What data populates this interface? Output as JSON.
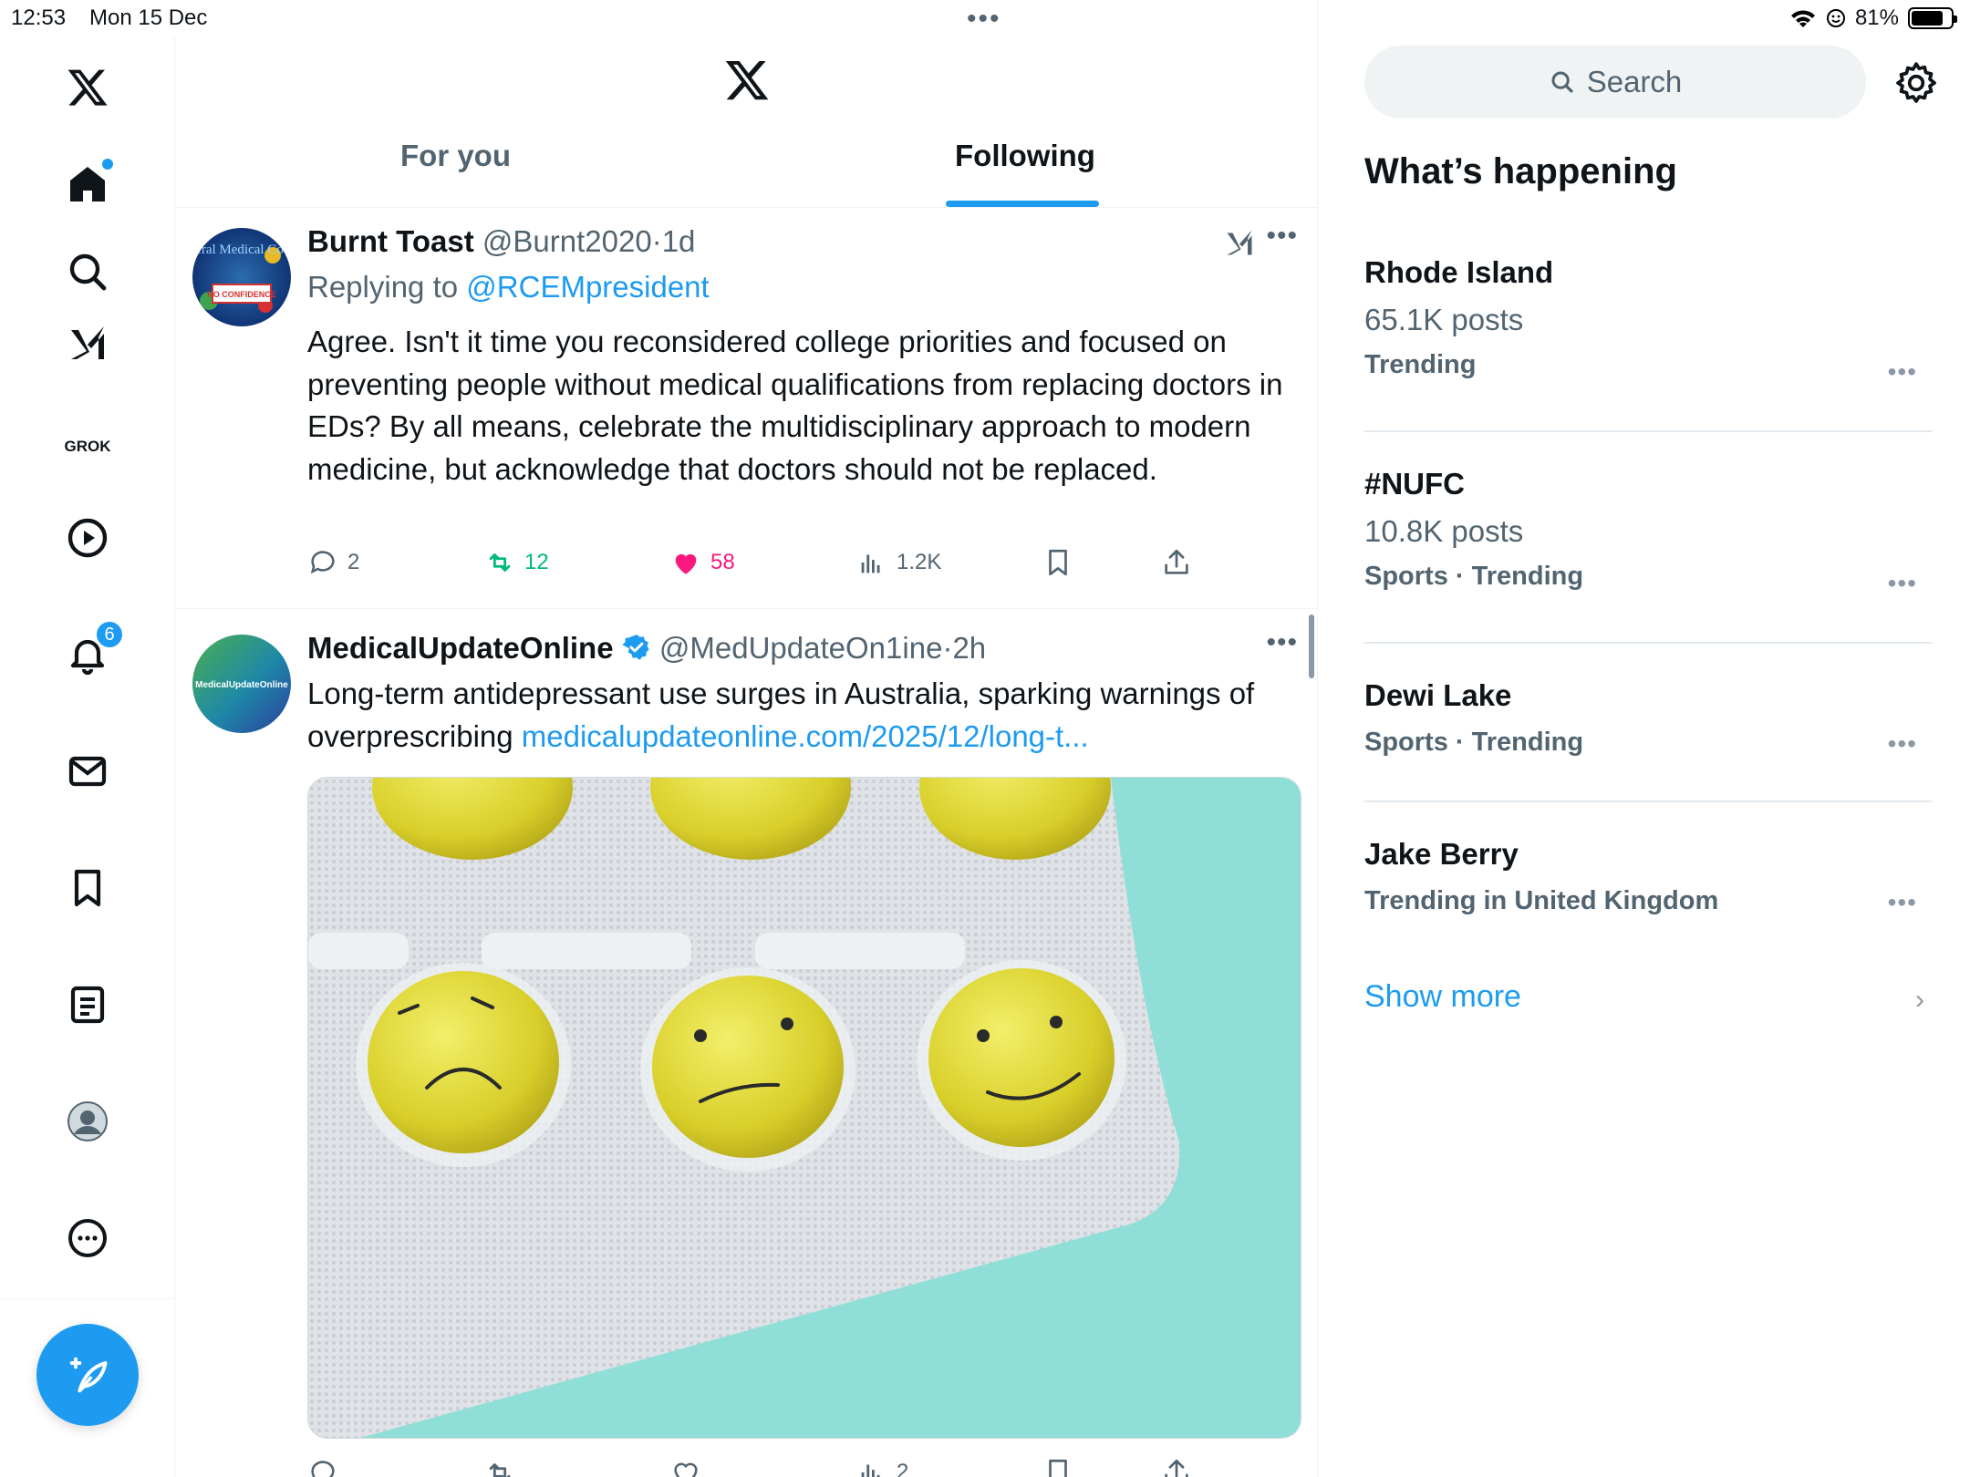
{
  "status_bar": {
    "time": "12:53",
    "date": "Mon 15 Dec",
    "battery": "81%",
    "battery_level": 0.81
  },
  "nav": {
    "grok_label": "GROK",
    "notifications_count": "6",
    "icons": [
      "x-logo-icon",
      "home-icon",
      "search-icon",
      "grok-icon",
      "video-icon",
      "bell-icon",
      "mail-icon",
      "bookmark-icon",
      "lists-icon",
      "profile-icon",
      "more-icon",
      "compose-icon"
    ]
  },
  "header": {
    "tabs": [
      {
        "label": "For you",
        "active": false
      },
      {
        "label": "Following",
        "active": true
      }
    ]
  },
  "tweets": [
    {
      "name": "Burnt Toast",
      "handle": "@Burnt2020",
      "sep": "·",
      "time": "1d",
      "replying_prefix": "Replying to",
      "replying_to": "@RCEMpresident",
      "avatar_text": "General Medical Council",
      "avatar_stamp": "NO CONFIDENCE",
      "text": "Agree. Isn't it time you reconsidered college priorities and focused on preventing people without medical qualifications from replacing doctors in EDs? By all means, celebrate the multidisciplinary approach to modern medicine, but acknowledge that doctors should not be replaced.",
      "stats": {
        "replies": "2",
        "reposts": "12",
        "likes": "58",
        "views": "1.2K"
      },
      "liked": true,
      "accent_colors": {
        "repost": "#00ba7c",
        "like": "#f91880"
      }
    },
    {
      "name": "MedicalUpdateOnline",
      "verified": true,
      "handle": "@MedUpdateOn1ine",
      "sep": "·",
      "time": "2h",
      "avatar_text": "MedicalUpdateOnline",
      "text": "Long-term antidepressant use surges in Australia, sparking warnings of overprescribing",
      "link": "medicalupdateonline.com/2025/12/long-t...",
      "stats": {
        "replies": "",
        "reposts": "",
        "likes": "",
        "views": "2"
      }
    }
  ],
  "sidebar": {
    "search_placeholder": "Search",
    "title": "What’s happening",
    "trends": [
      {
        "name": "Rhode Island",
        "posts": "65.1K posts",
        "context": "Trending"
      },
      {
        "name": "#NUFC",
        "posts": "10.8K posts",
        "context": "Sports · Trending"
      },
      {
        "name": "Dewi Lake",
        "posts": "",
        "context": "Sports · Trending"
      },
      {
        "name": "Jake Berry",
        "posts": "",
        "context": "Trending in United Kingdom"
      }
    ],
    "show_more": "Show more"
  },
  "colors": {
    "accent": "#1d9bf0",
    "text": "#0f1419",
    "secondary": "#536471"
  }
}
